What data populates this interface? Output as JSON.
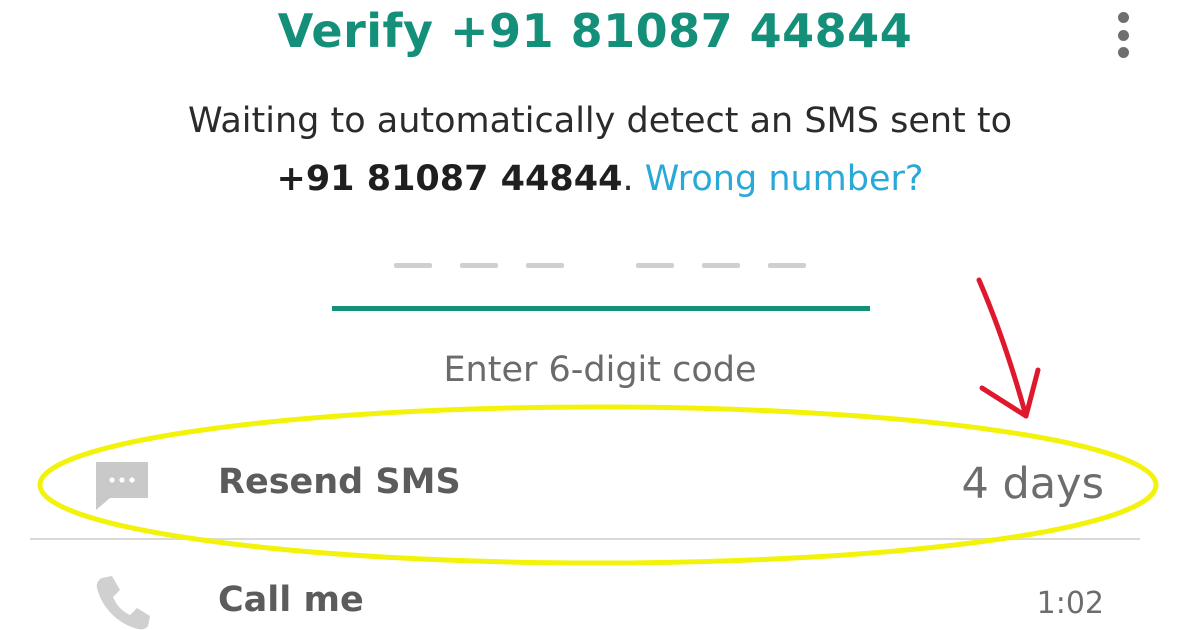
{
  "header": {
    "title": "Verify +91 81087 44844",
    "menu_icon": "more-vert-icon"
  },
  "description": {
    "line1": "Waiting to automatically detect an SMS sent to",
    "phone": "+91 81087 44844",
    "period": ".",
    "wrong_number_link": "Wrong number?"
  },
  "code_input": {
    "placeholder": "––– –––",
    "hint": "Enter 6-digit code"
  },
  "options": [
    {
      "icon": "message-icon",
      "label": "Resend SMS",
      "value": "4 days"
    },
    {
      "icon": "phone-icon",
      "label": "Call me",
      "value": "1:02"
    }
  ],
  "colors": {
    "accent": "#138f7a",
    "link": "#2aa9d8",
    "annotation_ellipse": "#f2f20a",
    "annotation_arrow": "#e0182d"
  }
}
